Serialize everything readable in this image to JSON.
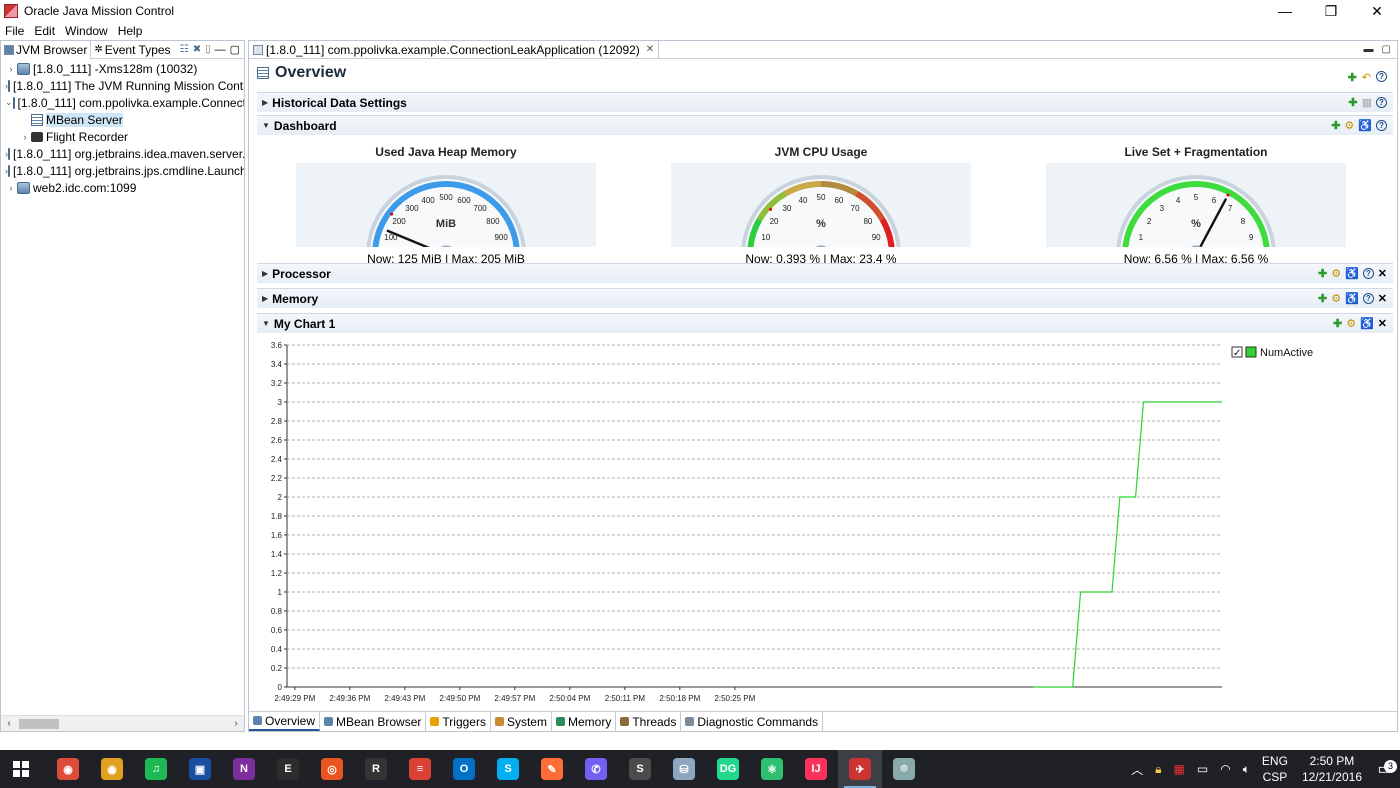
{
  "window": {
    "title": "Oracle Java Mission Control",
    "minimize": "—",
    "maximize": "❐",
    "close": "✕"
  },
  "menu": [
    "File",
    "Edit",
    "Window",
    "Help"
  ],
  "left_panel": {
    "tabs": [
      "JVM Browser",
      "Event Types"
    ],
    "tree": [
      {
        "label": "[1.8.0_111] -Xms128m (10032)",
        "expander": "›",
        "icon": "jvm-icon",
        "level": 0
      },
      {
        "label": "[1.8.0_111] The JVM Running Mission Control",
        "expander": "›",
        "icon": "jvm-icon",
        "level": 0
      },
      {
        "label": "[1.8.0_111] com.ppolivka.example.ConnectionLeakApplication",
        "expander": "⌄",
        "icon": "jvm-icon",
        "level": 0
      },
      {
        "label": "MBean Server",
        "expander": "",
        "icon": "mbean-icon",
        "level": 1,
        "selected": true
      },
      {
        "label": "Flight Recorder",
        "expander": "›",
        "icon": "flight-recorder-icon",
        "level": 1
      },
      {
        "label": "[1.8.0_111] org.jetbrains.idea.maven.server.RemoteMavenServer",
        "expander": "›",
        "icon": "jvm-icon",
        "level": 0
      },
      {
        "label": "[1.8.0_111] org.jetbrains.jps.cmdline.Launcher",
        "expander": "›",
        "icon": "jvm-icon",
        "level": 0
      },
      {
        "label": "web2.idc.com:1099",
        "expander": "›",
        "icon": "jvm-icon",
        "level": 0
      }
    ]
  },
  "editor": {
    "tab_label": "[1.8.0_111] com.ppolivka.example.ConnectionLeakApplication (12092)",
    "page_title": "Overview",
    "sections": {
      "historical": "Historical Data Settings",
      "dashboard": "Dashboard",
      "processor": "Processor",
      "memory": "Memory",
      "mychart": "My Chart 1"
    },
    "gauges": [
      {
        "title": "Used Java Heap Memory",
        "unit": "MiB",
        "ticks": [
          "0",
          "100",
          "200",
          "300",
          "400",
          "500",
          "600",
          "700",
          "800",
          "900",
          "1000"
        ],
        "max_tick": 1000,
        "value": 125,
        "max": 205,
        "readout": "Now: 125 MiB | Max: 205 MiB",
        "arc_color": "#3d9be9"
      },
      {
        "title": "JVM CPU Usage",
        "unit": "%",
        "ticks": [
          "0",
          "10",
          "20",
          "30",
          "40",
          "50",
          "60",
          "70",
          "80",
          "90",
          "100"
        ],
        "max_tick": 100,
        "value": 0.393,
        "max": 23.4,
        "readout": "Now: 0.393 % | Max: 23.4 %",
        "arc_color": "gradient"
      },
      {
        "title": "Live Set + Fragmentation",
        "unit": "%",
        "ticks": [
          "0",
          "1",
          "2",
          "3",
          "4",
          "5",
          "6",
          "7",
          "8",
          "9",
          "10"
        ],
        "max_tick": 10,
        "value": 6.56,
        "max": 6.56,
        "readout": "Now: 6.56 % | Max: 6.56 %",
        "arc_color": "#3fdc3f"
      }
    ],
    "bottom_tabs": [
      "Overview",
      "MBean Browser",
      "Triggers",
      "System",
      "Memory",
      "Threads",
      "Diagnostic Commands"
    ]
  },
  "chart_data": {
    "type": "line",
    "series": [
      {
        "name": "NumActive",
        "color": "#2ed32e",
        "x": [
          "2:50:04 PM",
          "2:50:09 PM",
          "2:50:10 PM",
          "2:50:14 PM",
          "2:50:15 PM",
          "2:50:17 PM",
          "2:50:18 PM",
          "2:50:28 PM"
        ],
        "x_seconds_offset": [
          95,
          100,
          101,
          105,
          106,
          108,
          109,
          119
        ],
        "values": [
          0,
          0,
          1,
          1,
          2,
          2,
          3,
          3
        ]
      }
    ],
    "x_ticks": [
      "2:49:29 PM",
      "2:49:36 PM",
      "2:49:43 PM",
      "2:49:50 PM",
      "2:49:57 PM",
      "2:50:04 PM",
      "2:50:11 PM",
      "2:50:18 PM",
      "2:50:25 PM"
    ],
    "y_ticks": [
      "0",
      "0.2",
      "0.4",
      "0.6",
      "0.8",
      "1",
      "1.2",
      "1.4",
      "1.6",
      "1.8",
      "2",
      "2.2",
      "2.4",
      "2.6",
      "2.8",
      "3",
      "3.2",
      "3.4",
      "3.6"
    ],
    "ylim": [
      0,
      3.6
    ],
    "xlim_seconds": [
      0,
      119
    ],
    "legend_placement": "top-right",
    "grid": true
  },
  "taskbar": {
    "apps": [
      {
        "name": "chrome-icon",
        "color": "#dd4b39",
        "label": "◉"
      },
      {
        "name": "chrome-canary-icon",
        "color": "#e0a020",
        "label": "◉"
      },
      {
        "name": "spotify-icon",
        "color": "#1db954",
        "label": "♫"
      },
      {
        "name": "save-icon",
        "color": "#1a4ea1",
        "label": "▣"
      },
      {
        "name": "onenote-icon",
        "color": "#7b2e9c",
        "label": "N"
      },
      {
        "name": "terminal-icon",
        "color": "#2d2d2d",
        "label": "E"
      },
      {
        "name": "ubuntu-icon",
        "color": "#e95420",
        "label": "◎"
      },
      {
        "name": "rstudio-icon",
        "color": "#333333",
        "label": "R"
      },
      {
        "name": "todoist-icon",
        "color": "#db4035",
        "label": "≡"
      },
      {
        "name": "outlook-icon",
        "color": "#0072c6",
        "label": "O"
      },
      {
        "name": "skype-icon",
        "color": "#00aff0",
        "label": "S"
      },
      {
        "name": "postman-icon",
        "color": "#ff6c37",
        "label": "✎"
      },
      {
        "name": "viber-icon",
        "color": "#7360f2",
        "label": "✆"
      },
      {
        "name": "sublime-icon",
        "color": "#4b4b4b",
        "label": "S"
      },
      {
        "name": "database-icon",
        "color": "#8da7c0",
        "label": "⛁"
      },
      {
        "name": "datagrip-icon",
        "color": "#22d88f",
        "label": "DG"
      },
      {
        "name": "atom-icon",
        "color": "#2fbf71",
        "label": "⚛"
      },
      {
        "name": "intellij-icon",
        "color": "#fe315d",
        "label": "IJ"
      },
      {
        "name": "mission-control-icon",
        "color": "#c33",
        "label": "✈",
        "active": true
      },
      {
        "name": "network-tool-icon",
        "color": "#8aa",
        "label": "⌾"
      }
    ],
    "tray_lang": [
      "ENG",
      "CSP"
    ],
    "time": "2:50 PM",
    "date": "12/21/2016",
    "notification_count": "3"
  }
}
